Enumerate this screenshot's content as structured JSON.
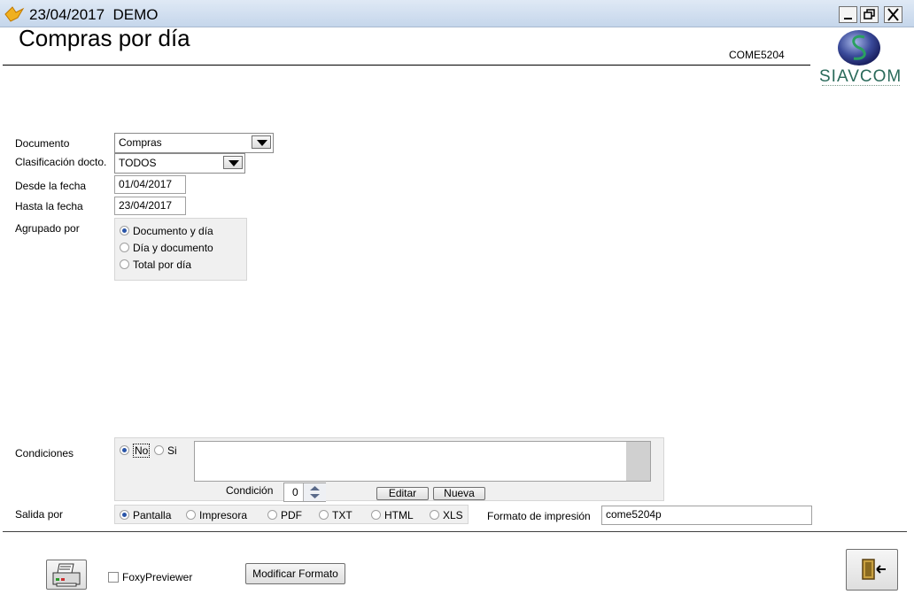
{
  "window": {
    "title": "23/04/2017  DEMO",
    "buttons": {
      "minimize": "_",
      "restore": "🗗",
      "close": "X"
    }
  },
  "header": {
    "title": "Compras por día",
    "code": "COME5204",
    "logo_text": "SIAVCOM"
  },
  "form": {
    "documento": {
      "label": "Documento",
      "value": "Compras"
    },
    "clasificacion": {
      "label": "Clasificación docto.",
      "value": "TODOS"
    },
    "desde": {
      "label": "Desde la fecha",
      "value": "01/04/2017"
    },
    "hasta": {
      "label": "Hasta la fecha",
      "value": "23/04/2017"
    },
    "agrupado": {
      "label": "Agrupado por",
      "options": [
        "Documento y día",
        "Día y documento",
        "Total por día"
      ],
      "selected": "Documento y día"
    },
    "condiciones": {
      "label": "Condiciones",
      "options": [
        "No",
        "Si"
      ],
      "selected": "No",
      "condicion_label": "Condición",
      "condicion_value": "0",
      "edit_button": "Editar",
      "new_button": "Nueva"
    },
    "salida": {
      "label": "Salida por",
      "options": [
        "Pantalla",
        "Impresora",
        "PDF",
        "TXT",
        "HTML",
        "XLS"
      ],
      "selected": "Pantalla"
    },
    "formato": {
      "label": "Formato de impresión",
      "value": "come5204p"
    }
  },
  "footer": {
    "foxy_label": "FoxyPreviewer",
    "foxy_checked": false,
    "modify_button": "Modificar Formato",
    "print_icon": "printer-icon",
    "exit_icon": "exit-door-icon"
  }
}
